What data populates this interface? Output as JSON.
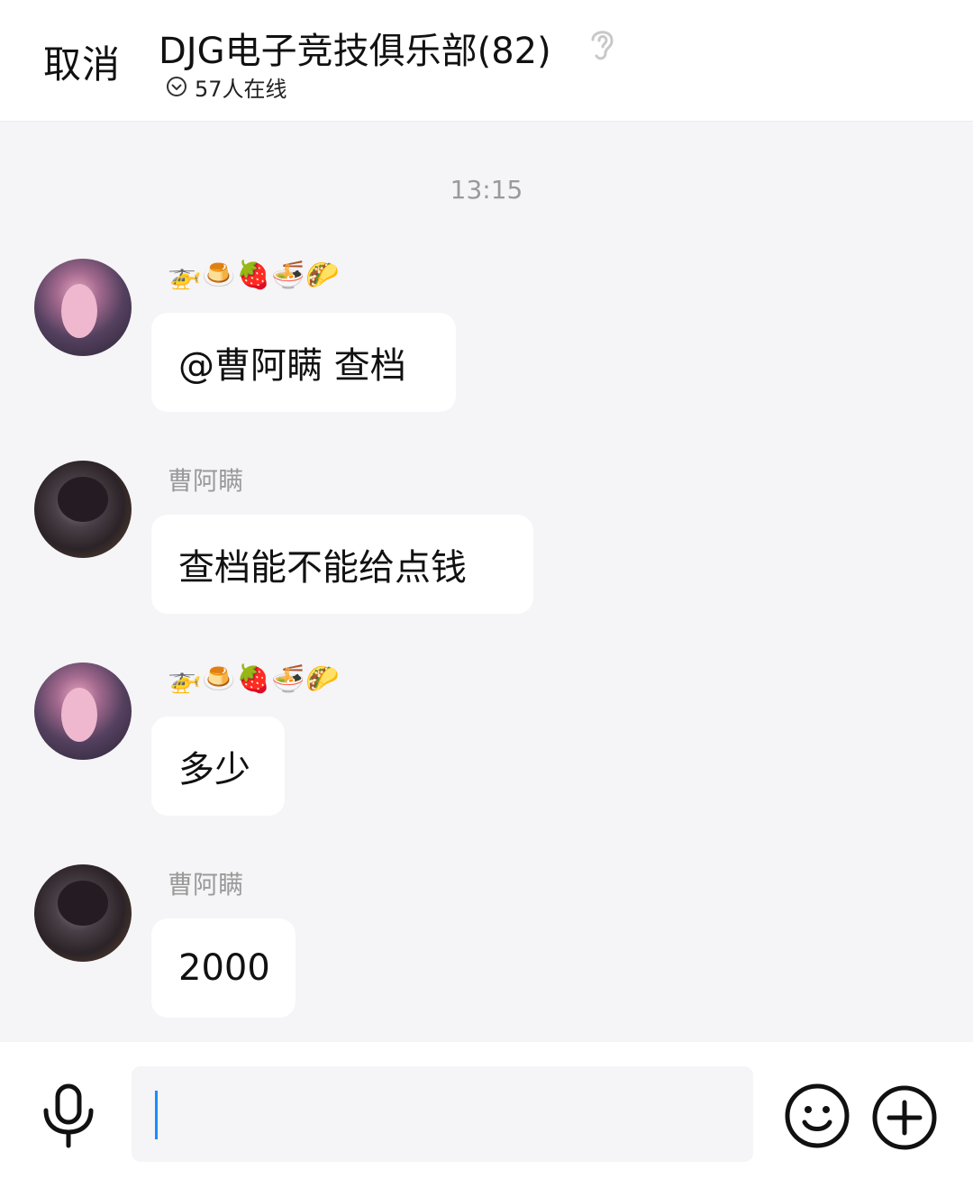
{
  "header": {
    "cancel_label": "取消",
    "group_title": "DJG电子竞技俱乐部(82)",
    "online_text": "57人在线"
  },
  "chat": {
    "timestamp": "13:15",
    "messages": [
      {
        "sender": "🚁🍮🍓🍜🌮",
        "text": "@曹阿瞒 查档"
      },
      {
        "sender": "曹阿瞒",
        "text": "查档能不能给点钱"
      },
      {
        "sender": "🚁🍮🍓🍜🌮",
        "text": "多少"
      },
      {
        "sender": "曹阿瞒",
        "text": "2000"
      }
    ]
  },
  "input_bar": {
    "message_value": "",
    "icons": [
      "mic-icon",
      "emoji-icon",
      "plus-icon"
    ]
  },
  "colors": {
    "background": "#f5f4f6",
    "bubble": "#ffffff",
    "caret": "#1a8cff",
    "muted_text": "#9a9a9a"
  }
}
